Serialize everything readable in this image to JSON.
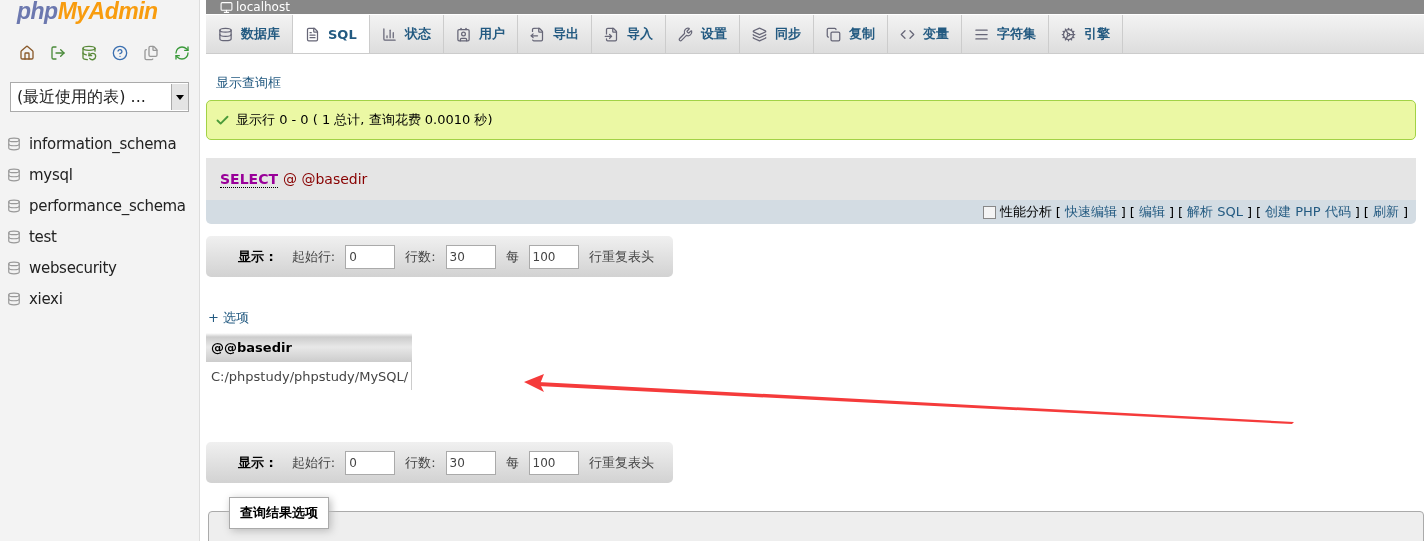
{
  "sidebar": {
    "logo": {
      "part1": "php",
      "part2": "MyAdmin"
    },
    "recent_tables": {
      "value": "(最近使用的表) ..."
    },
    "databases": [
      "information_schema",
      "mysql",
      "performance_schema",
      "test",
      "websecurity",
      "xiexi"
    ]
  },
  "top_bar": {
    "title": "localhost"
  },
  "tabs": [
    {
      "label": "数据库",
      "selected": false
    },
    {
      "label": "SQL",
      "selected": true
    },
    {
      "label": "状态",
      "selected": false
    },
    {
      "label": "用户",
      "selected": false
    },
    {
      "label": "导出",
      "selected": false
    },
    {
      "label": "导入",
      "selected": false
    },
    {
      "label": "设置",
      "selected": false
    },
    {
      "label": "同步",
      "selected": false
    },
    {
      "label": "复制",
      "selected": false
    },
    {
      "label": "变量",
      "selected": false
    },
    {
      "label": "字符集",
      "selected": false
    },
    {
      "label": "引擎",
      "selected": false
    }
  ],
  "toggle_query_box": "显示查询框",
  "success_message": "显示行 0 - 0 ( 1 总计, 查询花费 0.0010 秒)",
  "sql": {
    "keyword": "SELECT",
    "rest": "@ @basedir",
    "profiling": {
      "label": "性能分析",
      "checked": false
    },
    "links": [
      {
        "open": "[",
        "label": "快速编辑",
        "close": "]"
      },
      {
        "open": "[",
        "label": "编辑",
        "close": "]"
      },
      {
        "open": "[",
        "label": "解析 SQL",
        "close": "]"
      },
      {
        "open": "[",
        "label": "创建 PHP 代码",
        "close": "]"
      },
      {
        "open": "[",
        "label": "刷新",
        "close": "]"
      }
    ]
  },
  "navigation": [
    {
      "label": "显示 :",
      "start_label": "起始行:",
      "start": "0",
      "rows_label": "行数:",
      "rows": "30",
      "per_label": "每",
      "per": "100",
      "per_suffix": "行重复表头"
    },
    {
      "label": "显示 :",
      "start_label": "起始行:",
      "start": "0",
      "rows_label": "行数:",
      "rows": "30",
      "per_label": "每",
      "per": "100",
      "per_suffix": "行重复表头"
    }
  ],
  "options_toggle": "+ 选项",
  "table": {
    "columns": [
      "@@basedir"
    ],
    "rows": [
      [
        "C:/phpstudy/phpstudy/MySQL/"
      ]
    ]
  },
  "result_options": {
    "legend": "查询结果选项"
  }
}
